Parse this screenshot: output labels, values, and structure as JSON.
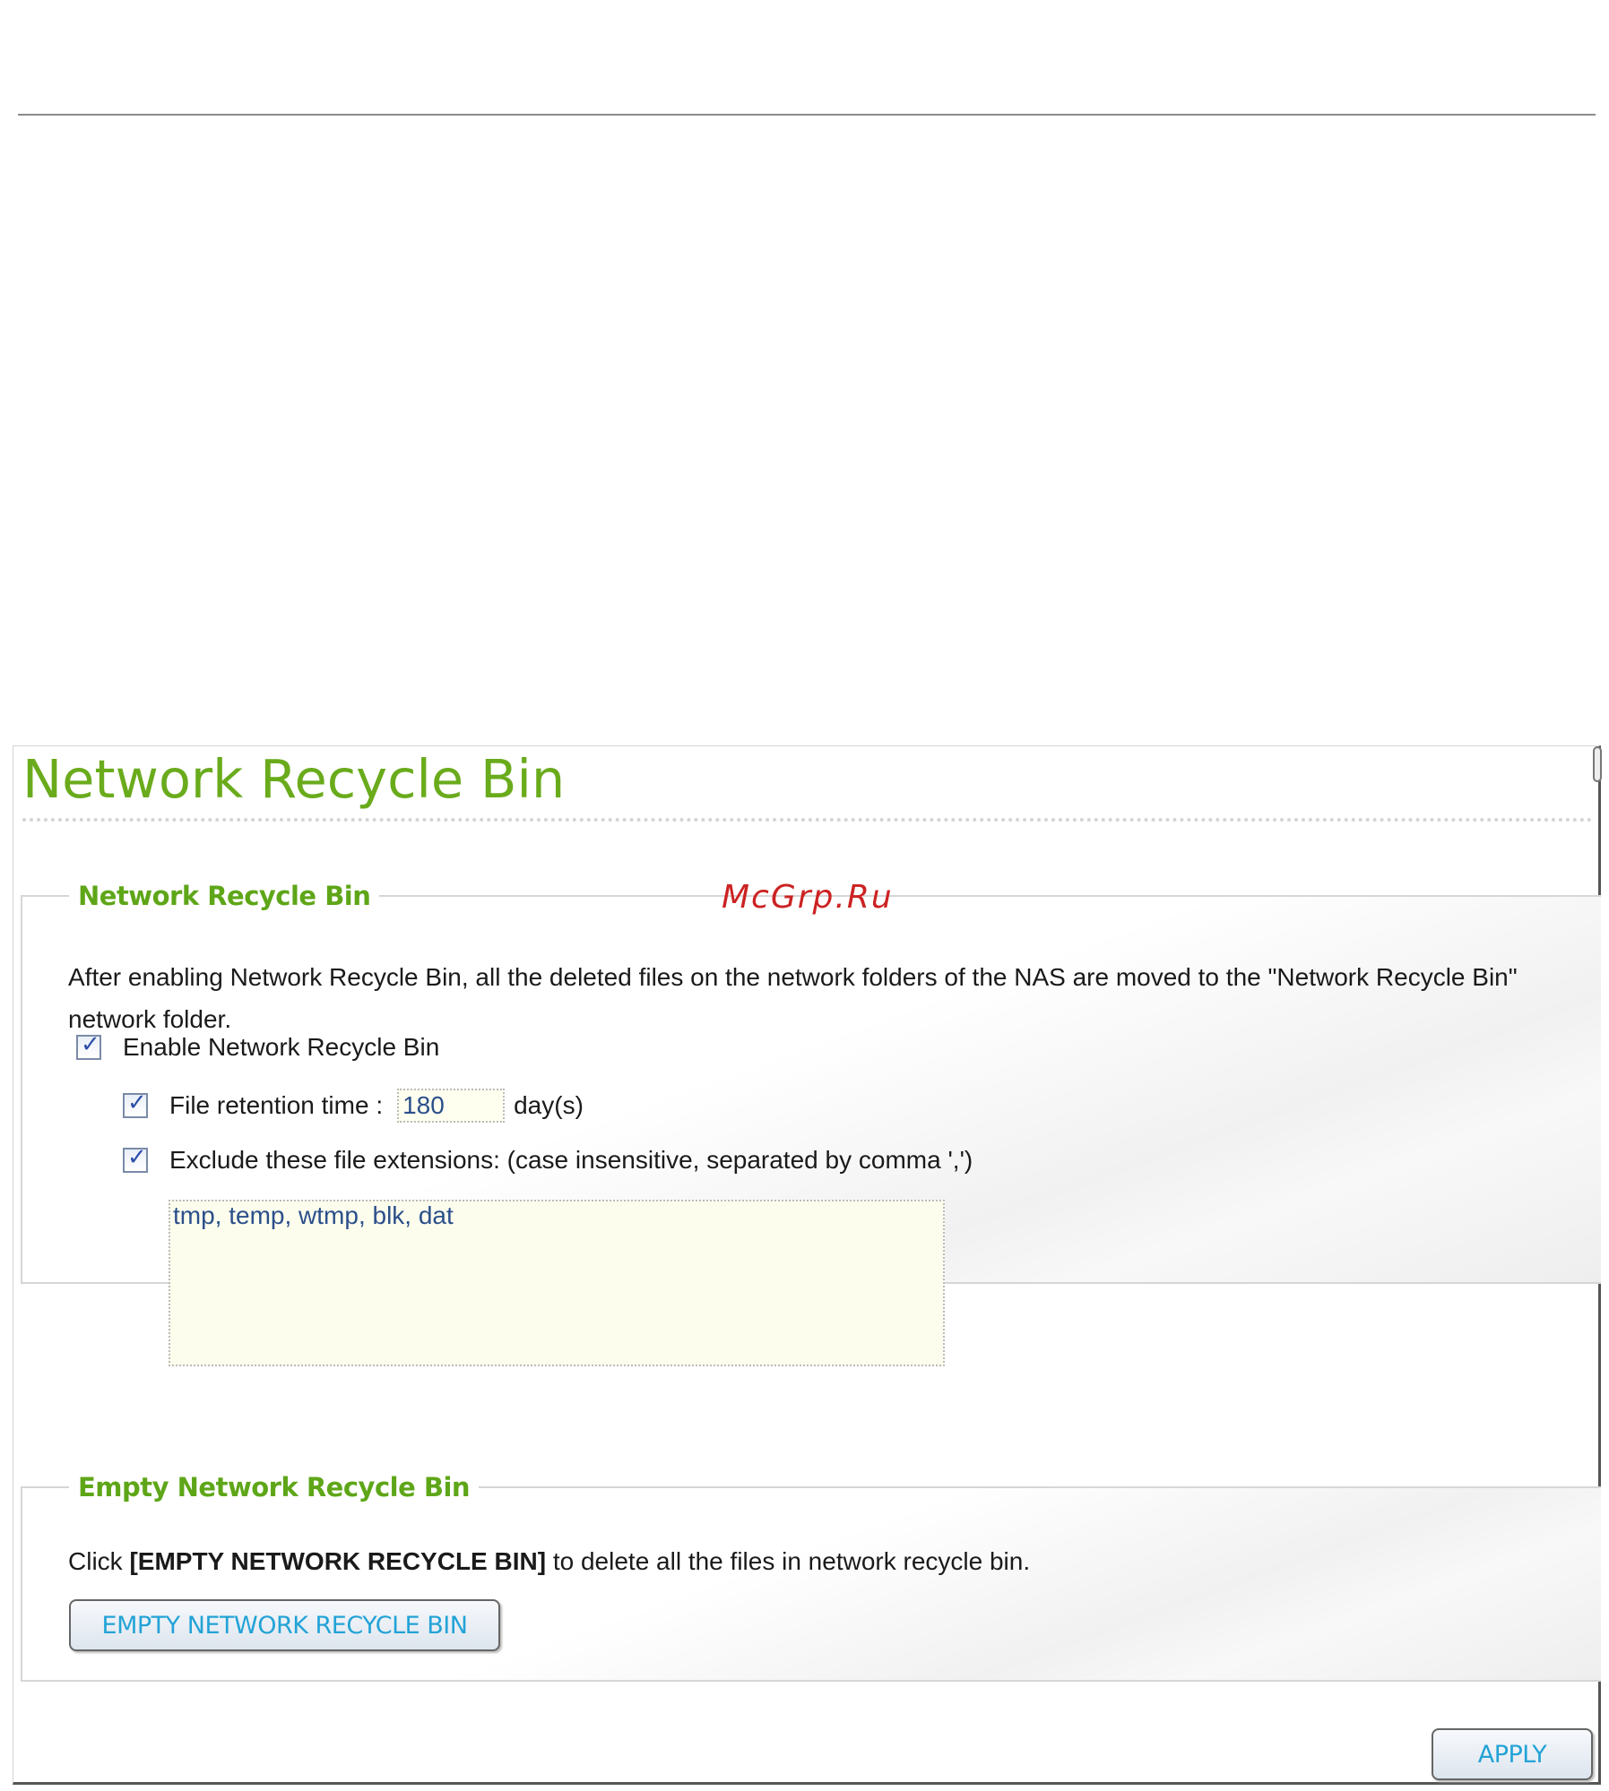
{
  "page_title": "Network Recycle Bin",
  "watermark": "McGrp.Ru",
  "recycle_section": {
    "legend": "Network Recycle Bin",
    "description": "After enabling Network Recycle Bin, all the deleted files on the network folders of the NAS are moved to the \"Network Recycle Bin\" network folder.",
    "enable_label": "Enable Network Recycle Bin",
    "enable_checked": true,
    "retention_label": "File retention time :",
    "retention_value": "180",
    "retention_unit": "day(s)",
    "retention_checked": true,
    "exclude_label": "Exclude these file extensions:  (case insensitive, separated by comma ',')",
    "exclude_checked": true,
    "extensions_value": "tmp, temp, wtmp, blk, dat"
  },
  "empty_section": {
    "legend": "Empty Network Recycle Bin",
    "desc_prefix": "Click ",
    "desc_bold": "[EMPTY NETWORK RECYCLE BIN]",
    "desc_suffix": " to delete all the files in network recycle bin.",
    "button_label": "EMPTY NETWORK RECYCLE BIN"
  },
  "apply_label": "APPLY",
  "check_glyph": "✓",
  "colors": {
    "title_green": "#6aab1c",
    "legend_green": "#5ea618",
    "button_text_blue": "#23a3d6",
    "input_text_blue": "#2b4f8a"
  }
}
